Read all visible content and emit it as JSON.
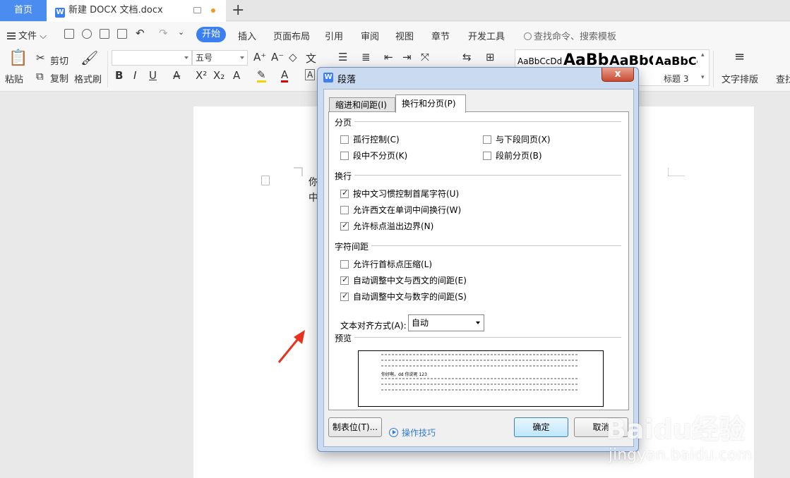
{
  "tabs": {
    "home": "首页",
    "doc_icon": "W",
    "doc_title": "新建 DOCX 文档.docx",
    "add": "+"
  },
  "menu": {
    "file": "文件",
    "start": "开始",
    "items": [
      "插入",
      "页面布局",
      "引用",
      "审阅",
      "视图",
      "章节",
      "开发工具"
    ],
    "search_placeholder": "查找命令、搜索模板"
  },
  "ribbon": {
    "paste": "粘贴",
    "cut": "剪切",
    "copy": "复制",
    "format_painter": "格式刷",
    "font_name": "",
    "font_size": "五号",
    "bold": "B",
    "italic": "I",
    "underline": "U",
    "styles": [
      "AaBbCcDd",
      "AaBb",
      "AaBbC",
      "AaBbCc"
    ],
    "style_labels": [
      "标题 3"
    ],
    "text_layout": "文字排版",
    "find": "查找"
  },
  "document": {
    "line1": "你",
    "line2": "中"
  },
  "dialog": {
    "title": "段落",
    "close": "x",
    "tab_indent": "缩进和间距(I)",
    "tab_breaks": "换行和分页(P)",
    "section_pagination": "分页",
    "widow_control": {
      "label": "孤行控制(C)",
      "checked": false
    },
    "keep_with_next": {
      "label": "与下段同页(X)",
      "checked": false
    },
    "keep_lines_together": {
      "label": "段中不分页(K)",
      "checked": false
    },
    "page_break_before": {
      "label": "段前分页(B)",
      "checked": false
    },
    "section_linebreak": "换行",
    "chinese_rules": {
      "label": "按中文习惯控制首尾字符(U)",
      "checked": true
    },
    "allow_latin_wrap": {
      "label": "允许西文在单词中间换行(W)",
      "checked": false
    },
    "allow_punct_overflow": {
      "label": "允许标点溢出边界(N)",
      "checked": true
    },
    "section_spacing": "字符间距",
    "compress_punct": {
      "label": "允许行首标点压缩(L)",
      "checked": false
    },
    "auto_space_latin": {
      "label": "自动调整中文与西文的间距(E)",
      "checked": true
    },
    "auto_space_digit": {
      "label": "自动调整中文与数字的间距(S)",
      "checked": true
    },
    "text_align_label": "文本对齐方式(A):",
    "text_align_value": "自动",
    "section_preview": "预览",
    "preview_sample": "你好啊，dd 你说呢 123",
    "tabs_button": "制表位(T)...",
    "tips": "操作技巧",
    "ok": "确定",
    "cancel": "取消"
  },
  "watermark": {
    "brand": "Baidu经验",
    "url": "jingyan.baidu.com"
  },
  "colors": {
    "accent": "#3b7ff0",
    "arrow": "#e8321e"
  }
}
